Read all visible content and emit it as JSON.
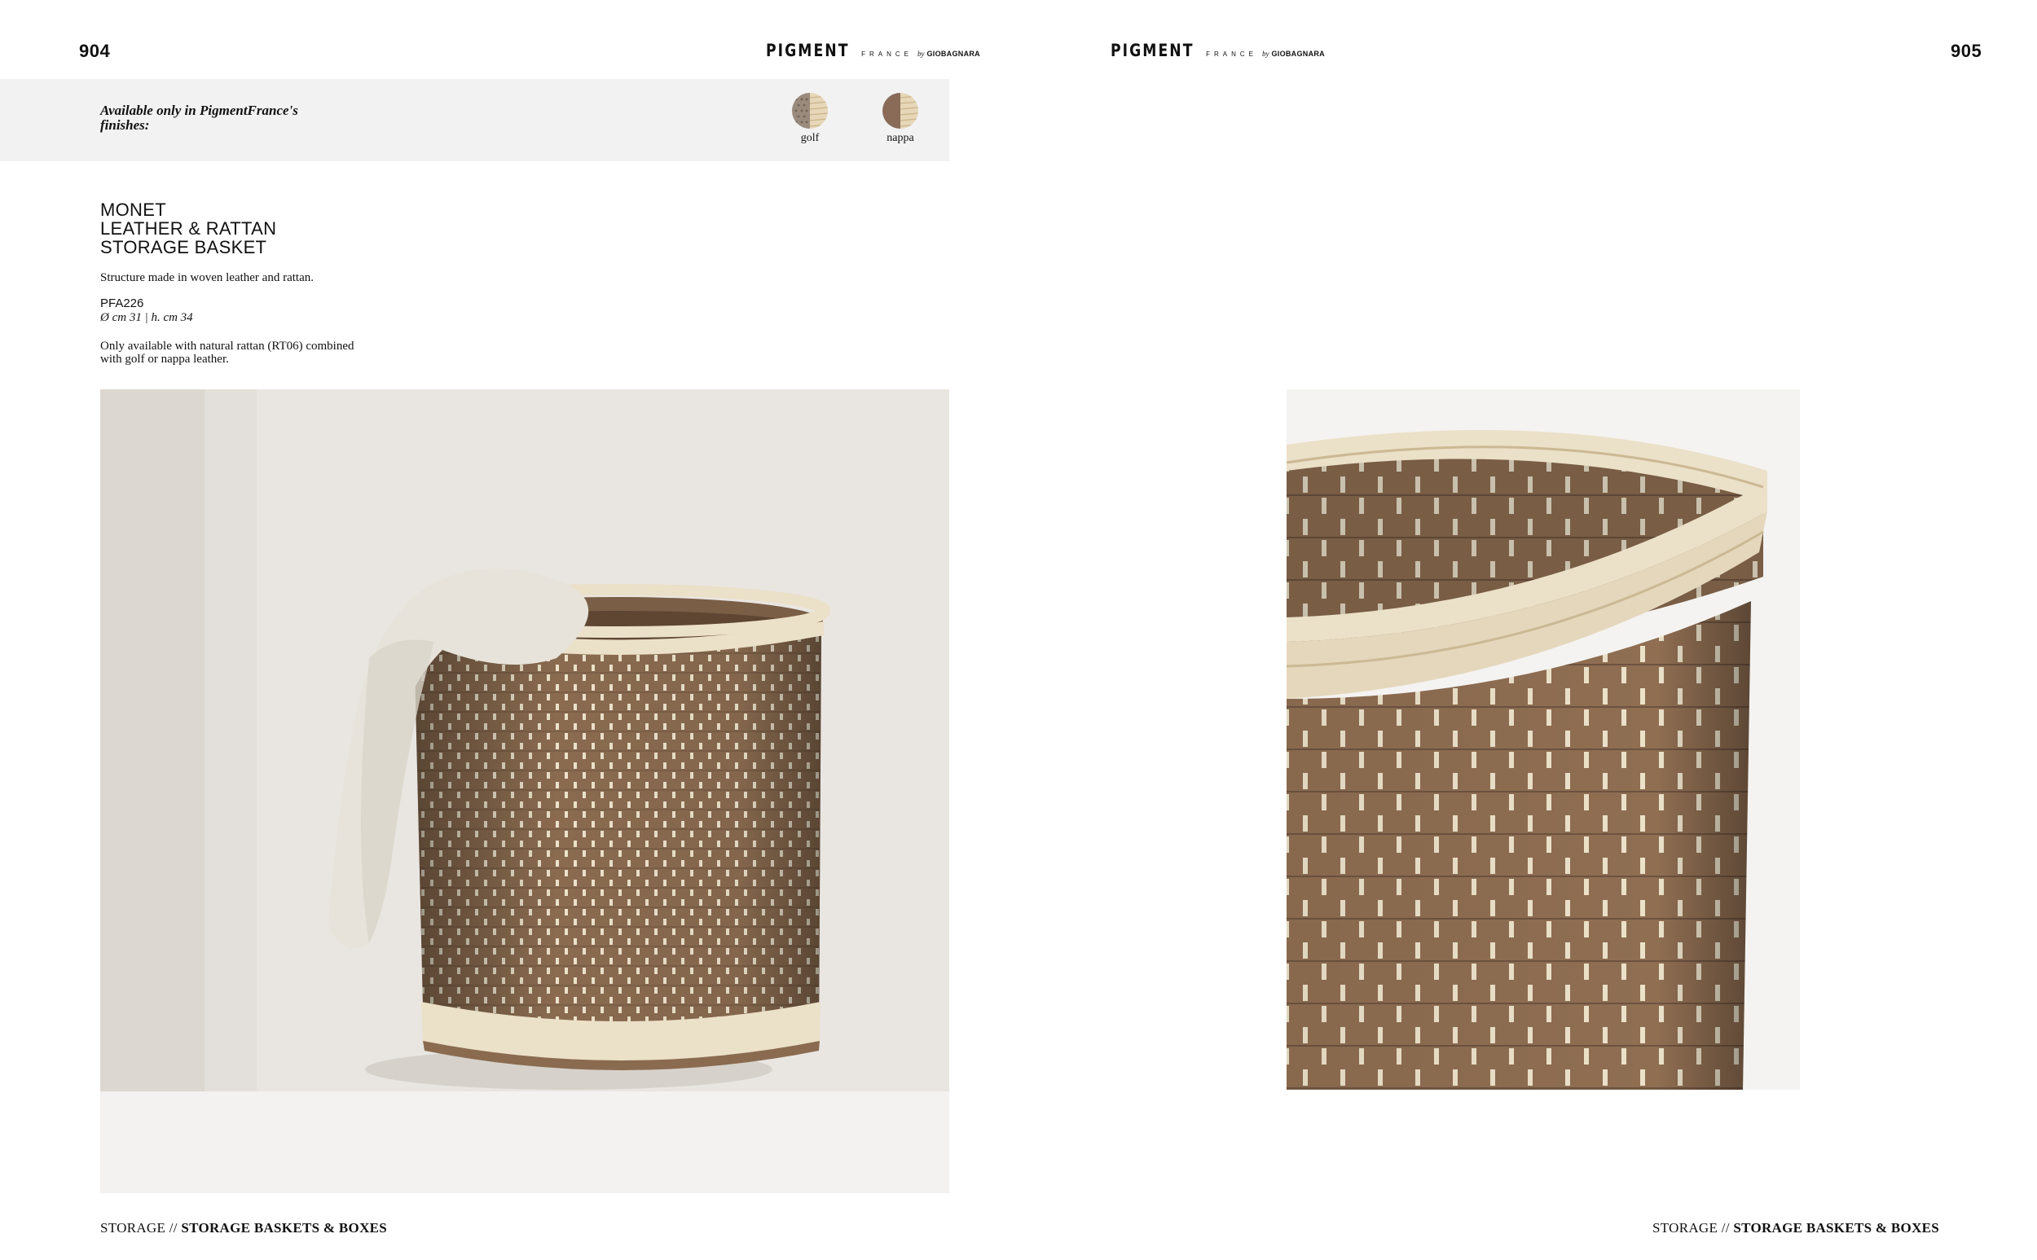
{
  "left_page": {
    "page_number": "904",
    "logo": {
      "main": "PIGMENT",
      "sub": "FRANCE",
      "by": "by",
      "brand": "GIOBAGNARA"
    },
    "finishes_heading": "Available only in PigmentFrance's finishes:",
    "finishes": [
      {
        "label": "golf",
        "icon": "golf-leather-swatch-icon"
      },
      {
        "label": "nappa",
        "icon": "nappa-leather-swatch-icon"
      }
    ],
    "product": {
      "title_lines": [
        "MONET",
        "LEATHER & RATTAN",
        "STORAGE BASKET"
      ],
      "description": "Structure made in woven leather and rattan.",
      "code": "PFA226",
      "dimensions": "Ø cm 31 | h. cm 34",
      "note": "Only available with natural rattan (RT06) combined with golf or nappa leather."
    },
    "footer": {
      "section": "STORAGE //",
      "subsection": "STORAGE BASKETS & BOXES"
    }
  },
  "right_page": {
    "page_number": "905",
    "logo": {
      "main": "PIGMENT",
      "sub": "FRANCE",
      "by": "by",
      "brand": "GIOBAGNARA"
    },
    "footer": {
      "section": "STORAGE //",
      "subsection": "STORAGE BASKETS & BOXES"
    }
  },
  "colors": {
    "leather": "#8a6b50",
    "rattan": "#ebe0c8",
    "band": "#f2f2f2",
    "wall": "#e9e6e2"
  }
}
